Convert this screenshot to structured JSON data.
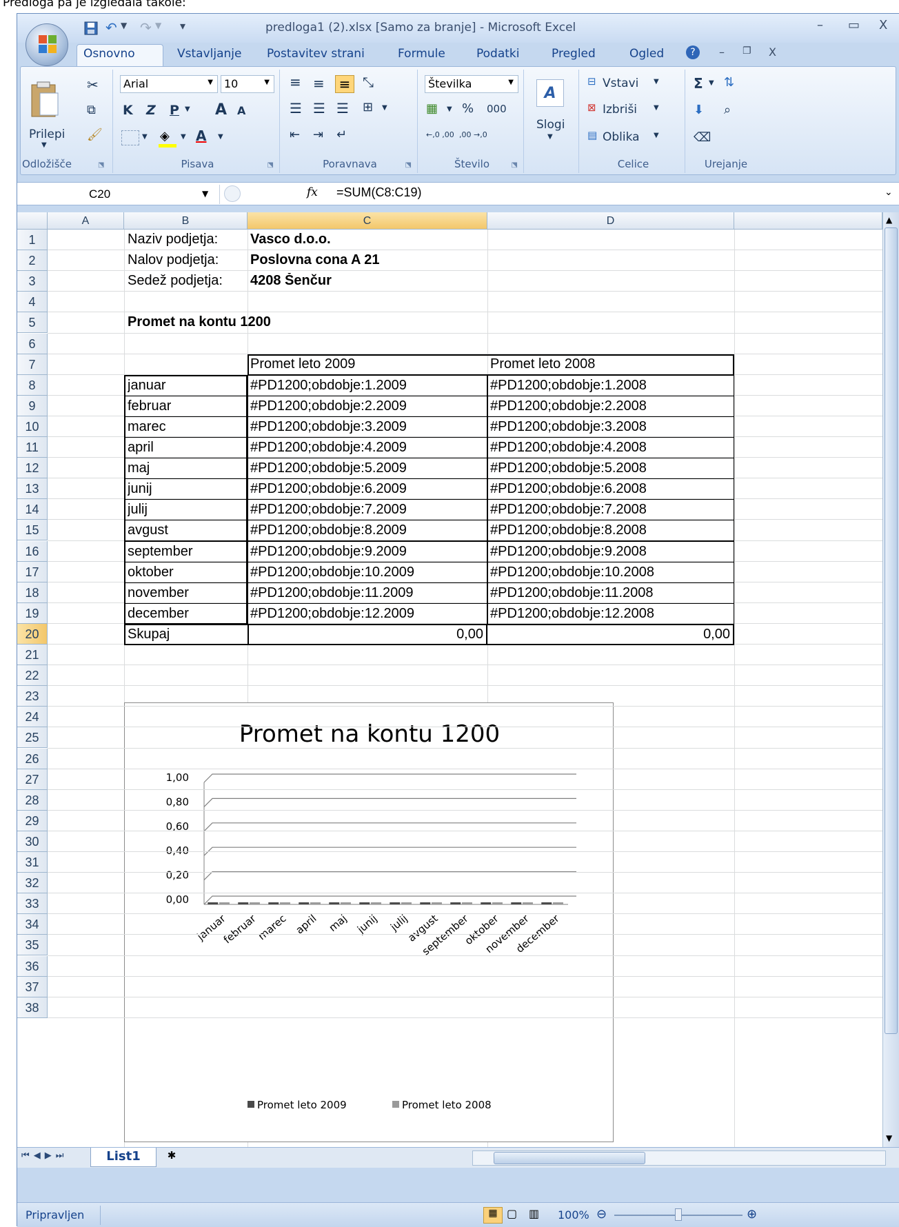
{
  "caption": "Predloga pa je izgledala takole:",
  "window": {
    "title": "predloga1 (2).xlsx  [Samo za branje] - Microsoft Excel",
    "minimize": "–",
    "maximize": "▭",
    "close": "X"
  },
  "ribbon_tabs": [
    "Osnovno",
    "Vstavljanje",
    "Postavitev strani",
    "Formule",
    "Podatki",
    "Pregled",
    "Ogled"
  ],
  "ribbon": {
    "clipboard": {
      "paste": "Prilepi",
      "label": "Odložišče"
    },
    "font": {
      "name": "Arial",
      "size": "10",
      "bold": "K",
      "italic": "Z",
      "underline": "P",
      "grow": "A",
      "shrink": "A",
      "label": "Pisava"
    },
    "alignment": {
      "label": "Poravnava"
    },
    "number": {
      "format": "Številka",
      "percent": "%",
      "thousands": "000",
      "inc_dec": "←,0 ,00",
      "dec_dec": ",00 →,0",
      "label": "Število"
    },
    "styles": {
      "label": "Slogi"
    },
    "cells": {
      "insert": "Vstavi",
      "delete": "Izbriši",
      "format": "Oblika",
      "label": "Celice"
    },
    "editing": {
      "sum": "Σ",
      "label": "Urejanje"
    }
  },
  "formula_bar": {
    "name_box": "C20",
    "fx": "fx",
    "formula": "=SUM(C8:C19)"
  },
  "columns": [
    "A",
    "B",
    "C",
    "D"
  ],
  "rows": [
    "1",
    "2",
    "3",
    "4",
    "5",
    "6",
    "7",
    "8",
    "9",
    "10",
    "11",
    "12",
    "13",
    "14",
    "15",
    "16",
    "17",
    "18",
    "19",
    "20",
    "21",
    "22",
    "23",
    "24",
    "25",
    "26",
    "27",
    "28",
    "29",
    "30",
    "31",
    "32",
    "33",
    "34",
    "35",
    "36",
    "37",
    "38"
  ],
  "header_info": [
    {
      "label": "Naziv podjetja:",
      "value": "Vasco d.o.o."
    },
    {
      "label": "Nalov podjetja:",
      "value": "Poslovna cona A 21"
    },
    {
      "label": "Sedež podjetja:",
      "value": "4208 Šenčur"
    }
  ],
  "section_title": "Promet na kontu 1200",
  "table": {
    "headers": [
      "Promet leto 2009",
      "Promet leto 2008"
    ],
    "rows": [
      {
        "month": "januar",
        "c": "#PD1200;obdobje:1.2009",
        "d": "#PD1200;obdobje:1.2008"
      },
      {
        "month": "februar",
        "c": "#PD1200;obdobje:2.2009",
        "d": "#PD1200;obdobje:2.2008"
      },
      {
        "month": "marec",
        "c": "#PD1200;obdobje:3.2009",
        "d": "#PD1200;obdobje:3.2008"
      },
      {
        "month": "april",
        "c": "#PD1200;obdobje:4.2009",
        "d": "#PD1200;obdobje:4.2008"
      },
      {
        "month": "maj",
        "c": "#PD1200;obdobje:5.2009",
        "d": "#PD1200;obdobje:5.2008"
      },
      {
        "month": "junij",
        "c": "#PD1200;obdobje:6.2009",
        "d": "#PD1200;obdobje:6.2008"
      },
      {
        "month": "julij",
        "c": "#PD1200;obdobje:7.2009",
        "d": "#PD1200;obdobje:7.2008"
      },
      {
        "month": "avgust",
        "c": "#PD1200;obdobje:8.2009",
        "d": "#PD1200;obdobje:8.2008"
      },
      {
        "month": "september",
        "c": "#PD1200;obdobje:9.2009",
        "d": "#PD1200;obdobje:9.2008"
      },
      {
        "month": "oktober",
        "c": "#PD1200;obdobje:10.2009",
        "d": "#PD1200;obdobje:10.2008"
      },
      {
        "month": "november",
        "c": "#PD1200;obdobje:11.2009",
        "d": "#PD1200;obdobje:11.2008"
      },
      {
        "month": "december",
        "c": "#PD1200;obdobje:12.2009",
        "d": "#PD1200;obdobje:12.2008"
      }
    ],
    "total": {
      "label": "Skupaj",
      "c": "0,00",
      "d": "0,00"
    }
  },
  "chart_data": {
    "type": "bar",
    "title": "Promet na kontu 1200",
    "categories": [
      "januar",
      "februar",
      "marec",
      "april",
      "maj",
      "junij",
      "julij",
      "avgust",
      "september",
      "oktober",
      "november",
      "december"
    ],
    "series": [
      {
        "name": "Promet leto 2009",
        "values": [
          0,
          0,
          0,
          0,
          0,
          0,
          0,
          0,
          0,
          0,
          0,
          0
        ]
      },
      {
        "name": "Promet leto 2008",
        "values": [
          0,
          0,
          0,
          0,
          0,
          0,
          0,
          0,
          0,
          0,
          0,
          0
        ]
      }
    ],
    "yticks": [
      "0,00",
      "0,20",
      "0,40",
      "0,60",
      "0,80",
      "1,00"
    ],
    "ylim": [
      0,
      1
    ],
    "legend": "bottom",
    "grid": true
  },
  "sheet_tab": "List1",
  "status": {
    "ready": "Pripravljen",
    "zoom": "100%"
  },
  "colors": {
    "accent": "#15428b",
    "selected_header": "#f9d99b",
    "ribbon_bg": "#d6e4f5"
  }
}
